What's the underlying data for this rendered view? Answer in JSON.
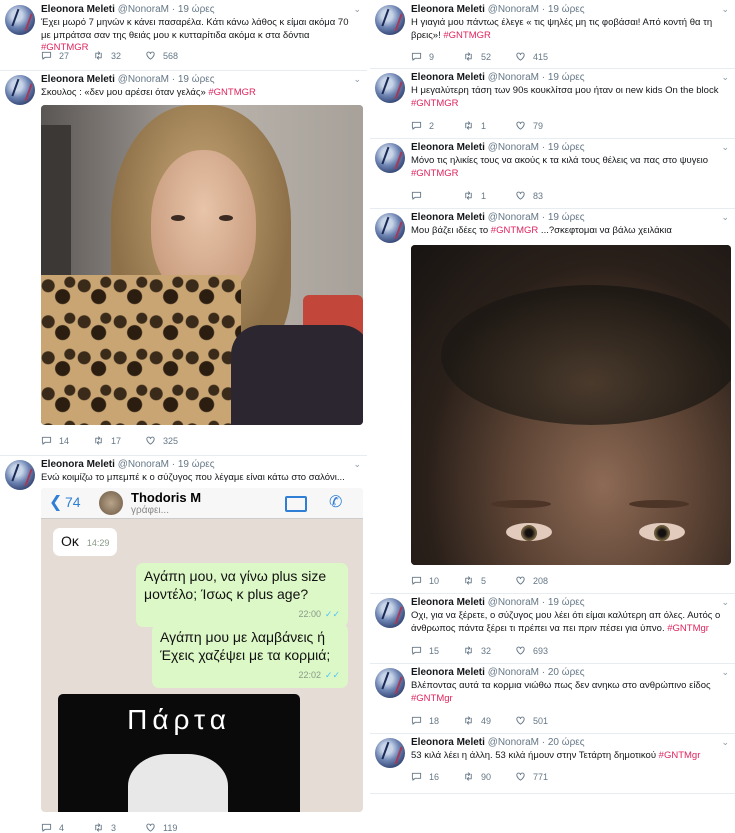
{
  "colors": {
    "hashtag": "#e0245e",
    "meta": "#657786",
    "wa_blue": "#2f7fd6",
    "wa_out": "#dcf8c6",
    "wa_bg": "#e5ddd5"
  },
  "icons": [
    "reply-icon",
    "retweet-icon",
    "like-icon",
    "chevron-down-icon",
    "avatar"
  ],
  "left": {
    "t1": {
      "name": "Eleonora Meleti",
      "handle": "@NonoraM · 19 ώρες",
      "text": "Έχει μωρό 7 μηνών κ κάνει πασαρέλα. Κάτι κάνω λάθος κ είμαι ακόμα 70 με μπράτσα σαν της θειάς μου κ κυτταρίτιδα ακόμα κ στα δόντια ",
      "tag": "#GNTMGR",
      "replies": "27",
      "retweets": "32",
      "likes": "568"
    },
    "t2": {
      "name": "Eleonora Meleti",
      "handle": "@NonoraM · 19 ώρες",
      "text": "Σκουλος : «δεν μου αρέσει όταν γελάς» ",
      "tag": "#GNTMGR",
      "replies": "14",
      "retweets": "17",
      "likes": "325"
    },
    "t3": {
      "name": "Eleonora Meleti",
      "handle": "@NonoraM · 19 ώρες",
      "text": "Ενώ κοιμίζω το μπεμπέ κ ο σύζυγος που λέγαμε είναι κάτω στο σαλόνι...",
      "replies": "4",
      "retweets": "3",
      "likes": "119",
      "whatsapp": {
        "back_count": "74",
        "contact": "Thodoris M",
        "status": "γράφει...",
        "msg1": "Οκ",
        "msg1_time": "14:29",
        "msg2": "Αγάπη μου, να γίνω plus size μοντέλο; Ίσως κ plus age?",
        "msg2_time": "22:00",
        "msg3": "Αγάπη μου με λαμβάνεις ή Έχεις χαζέψει με τα κορμιά;",
        "msg3_time": "22:02",
        "image_text": "Πάρτα"
      }
    }
  },
  "right": {
    "t1": {
      "name": "Eleonora Meleti",
      "handle": "@NonoraM · 19 ώρες",
      "text": "Η γιαγιά μου πάντως έλεγε « τις ψηλές μη τις φοβάσαι! Από κοντή θα τη βρεις»! ",
      "tag": "#GNTMGR",
      "replies": "9",
      "retweets": "52",
      "likes": "415"
    },
    "t2": {
      "name": "Eleonora Meleti",
      "handle": "@NonoraM · 19 ώρες",
      "text": "Η μεγαλύτερη τάση των 90s κουκλίτσα μου ήταν οι new kids On the block ",
      "tag": "#GNTMGR",
      "replies": "2",
      "retweets": "1",
      "likes": "79"
    },
    "t3": {
      "name": "Eleonora Meleti",
      "handle": "@NonoraM · 19 ώρες",
      "text": "Μόνο τις ηλικίες τους να ακούς κ τα κιλά  τους θέλεις να πας στο ψυγειο ",
      "tag": "#GNTMGR",
      "replies": "",
      "retweets": "1",
      "likes": "83"
    },
    "t4": {
      "name": "Eleonora Meleti",
      "handle": "@NonoraM · 19 ώρες",
      "text_a": "Μου βάζει ιδέες το ",
      "tag": "#GNTMGR",
      "text_b": " ...?σκεφτομαι να βάλω χειλάκια",
      "replies": "10",
      "retweets": "5",
      "likes": "208"
    },
    "t5": {
      "name": "Eleonora Meleti",
      "handle": "@NonoraM · 19 ώρες",
      "text": "Οχι, για να ξέρετε, ο σύζυγος μου λέει ότι είμαι καλύτερη απ όλες. Αυτός ο άνθρωπος πάντα ξέρει τι πρέπει να πει πριν πέσει για ύπνο. ",
      "tag": "#GNTMgr",
      "replies": "15",
      "retweets": "32",
      "likes": "693"
    },
    "t6": {
      "name": "Eleonora Meleti",
      "handle": "@NonoraM · 20 ώρες",
      "text": "Βλέποντας αυτά τα κορμια νιώθω πως δεν ανηκω στο ανθρώπινο είδος ",
      "tag": "#GNTMgr",
      "replies": "18",
      "retweets": "49",
      "likes": "501"
    },
    "t7": {
      "name": "Eleonora Meleti",
      "handle": "@NonoraM · 20 ώρες",
      "text": "53 κιλά λέει η άλλη. 53 κιλά ήμουν στην Τετάρτη δημοτικού ",
      "tag": "#GNTMgr",
      "replies": "16",
      "retweets": "90",
      "likes": "771"
    }
  }
}
